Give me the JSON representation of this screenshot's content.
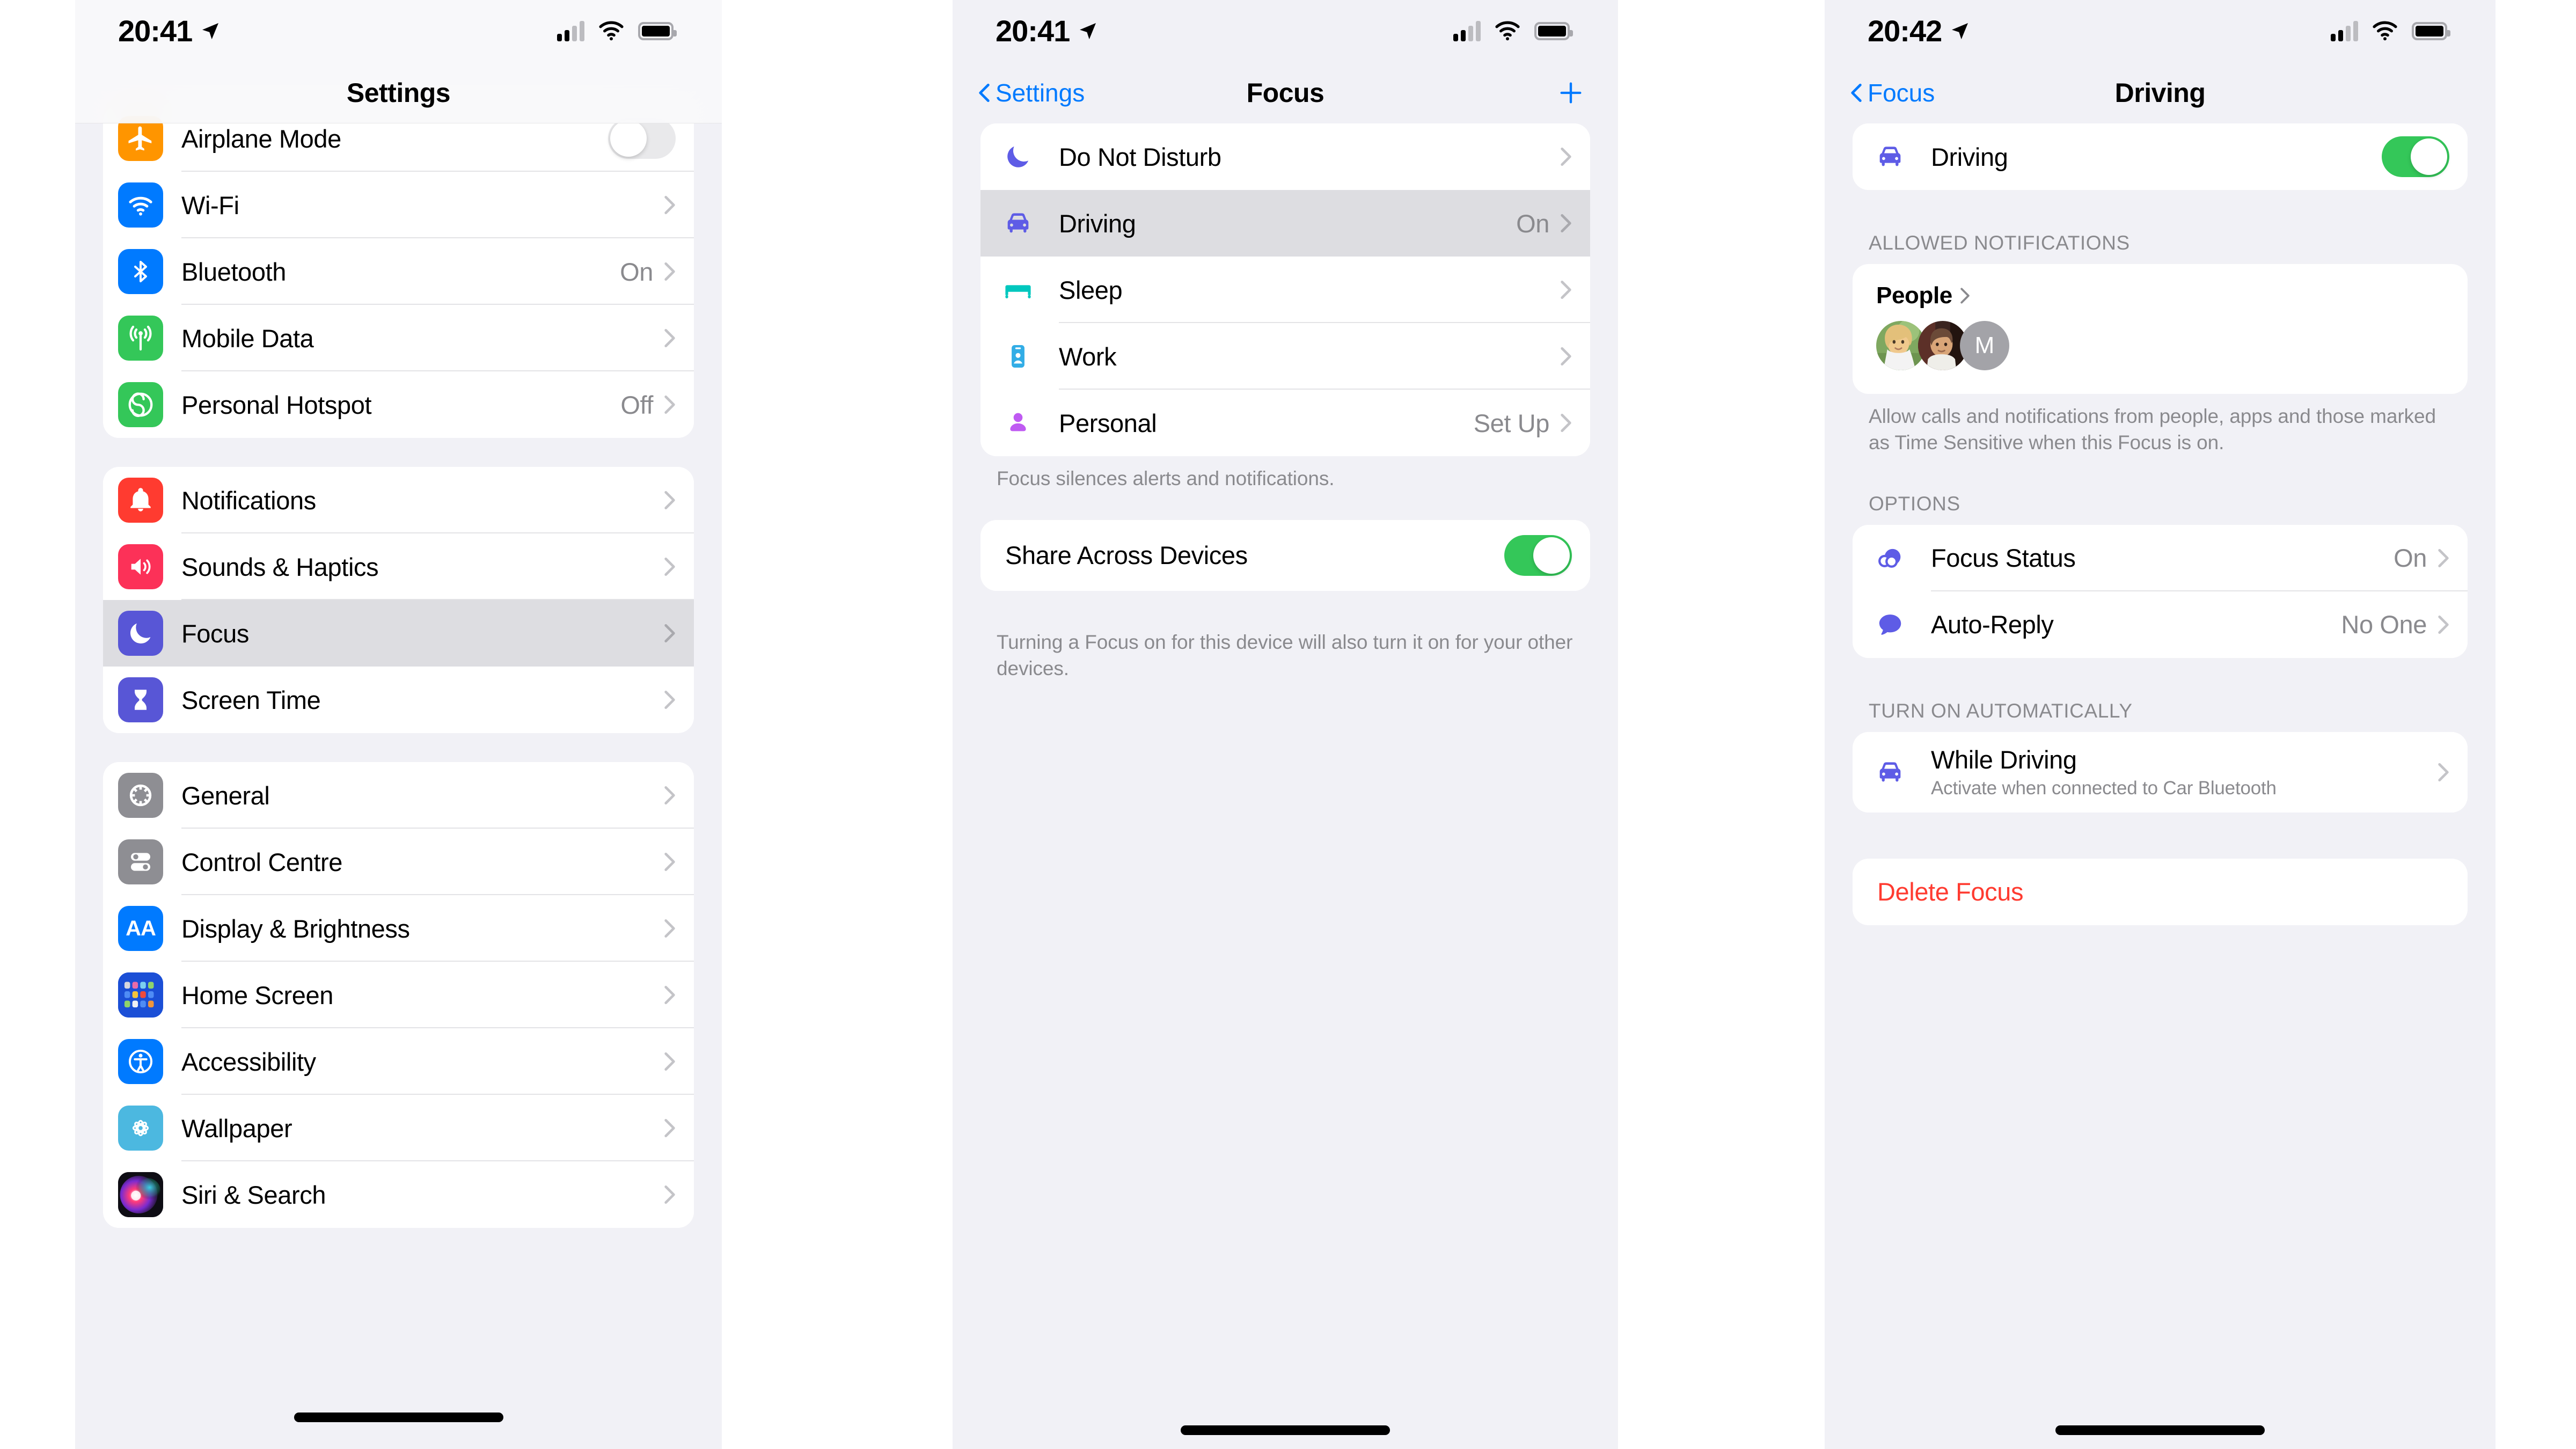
{
  "colors": {
    "accent_blue": "#007aff",
    "toggle_green": "#34c759",
    "danger_red": "#ff3b30",
    "indigo": "#5856d6",
    "group_bg": "#ffffff",
    "page_bg": "#f1f1f6",
    "selected_row": "#dddde1"
  },
  "phone1": {
    "status": {
      "time": "20:41",
      "location_icon": "location-arrow-icon",
      "signal_icon": "cellular-bars-icon",
      "wifi_icon": "wifi-icon",
      "battery_icon": "battery-icon"
    },
    "nav": {
      "title": "Settings"
    },
    "group1": [
      {
        "label": "Airplane Mode",
        "icon": "airplane-icon",
        "accessory": "toggle",
        "toggle_on": false
      },
      {
        "label": "Wi-Fi",
        "icon": "wifi-icon",
        "accessory": "chevron",
        "value": ""
      },
      {
        "label": "Bluetooth",
        "icon": "bluetooth-icon",
        "accessory": "chevron",
        "value": "On"
      },
      {
        "label": "Mobile Data",
        "icon": "cellular-icon",
        "accessory": "chevron",
        "value": ""
      },
      {
        "label": "Personal Hotspot",
        "icon": "hotspot-icon",
        "accessory": "chevron",
        "value": "Off"
      }
    ],
    "group2": [
      {
        "label": "Notifications",
        "icon": "notifications-bell-icon",
        "accessory": "chevron",
        "value": "",
        "selected": false
      },
      {
        "label": "Sounds & Haptics",
        "icon": "speaker-icon",
        "accessory": "chevron",
        "value": "",
        "selected": false
      },
      {
        "label": "Focus",
        "icon": "moon-icon",
        "accessory": "chevron",
        "value": "",
        "selected": true
      },
      {
        "label": "Screen Time",
        "icon": "hourglass-icon",
        "accessory": "chevron",
        "value": "",
        "selected": false
      }
    ],
    "group3": [
      {
        "label": "General",
        "icon": "gear-icon",
        "accessory": "chevron",
        "value": ""
      },
      {
        "label": "Control Centre",
        "icon": "control-centre-icon",
        "accessory": "chevron",
        "value": ""
      },
      {
        "label": "Display & Brightness",
        "icon": "display-brightness-icon",
        "accessory": "chevron",
        "value": ""
      },
      {
        "label": "Home Screen",
        "icon": "home-screen-icon",
        "accessory": "chevron",
        "value": ""
      },
      {
        "label": "Accessibility",
        "icon": "accessibility-icon",
        "accessory": "chevron",
        "value": ""
      },
      {
        "label": "Wallpaper",
        "icon": "wallpaper-icon",
        "accessory": "chevron",
        "value": ""
      },
      {
        "label": "Siri & Search",
        "icon": "siri-icon",
        "accessory": "chevron",
        "value": ""
      }
    ]
  },
  "phone2": {
    "status": {
      "time": "20:41"
    },
    "nav": {
      "back_label": "Settings",
      "title": "Focus",
      "add_button": "add-icon"
    },
    "focus_list": [
      {
        "label": "Do Not Disturb",
        "icon": "moon-icon",
        "value": "",
        "selected": false
      },
      {
        "label": "Driving",
        "icon": "car-icon",
        "value": "On",
        "selected": true
      },
      {
        "label": "Sleep",
        "icon": "bed-icon",
        "value": "",
        "selected": false
      },
      {
        "label": "Work",
        "icon": "work-badge-icon",
        "value": "",
        "selected": false
      },
      {
        "label": "Personal",
        "icon": "person-icon",
        "value": "Set Up",
        "selected": false
      }
    ],
    "focus_footer": "Focus silences alerts and notifications.",
    "share": {
      "label": "Share Across Devices",
      "toggle_on": true
    },
    "share_footer": "Turning a Focus on for this device will also turn it on for your other devices."
  },
  "phone3": {
    "status": {
      "time": "20:42"
    },
    "nav": {
      "back_label": "Focus",
      "title": "Driving"
    },
    "master": {
      "label": "Driving",
      "icon": "car-icon",
      "toggle_on": true
    },
    "allowed_header": "ALLOWED NOTIFICATIONS",
    "people": {
      "label": "People",
      "avatars": [
        "photo-avatar-1",
        "photo-avatar-2",
        "M"
      ]
    },
    "allowed_footer": "Allow calls and notifications from people, apps and those marked as Time Sensitive when this Focus is on.",
    "options_header": "OPTIONS",
    "options": [
      {
        "label": "Focus Status",
        "icon": "focus-status-icon",
        "value": "On"
      },
      {
        "label": "Auto-Reply",
        "icon": "message-bubble-icon",
        "value": "No One"
      }
    ],
    "auto_header": "TURN ON AUTOMATICALLY",
    "auto_items": [
      {
        "title": "While Driving",
        "subtitle": "Activate when connected to Car Bluetooth",
        "icon": "car-icon"
      }
    ],
    "delete_label": "Delete Focus"
  }
}
